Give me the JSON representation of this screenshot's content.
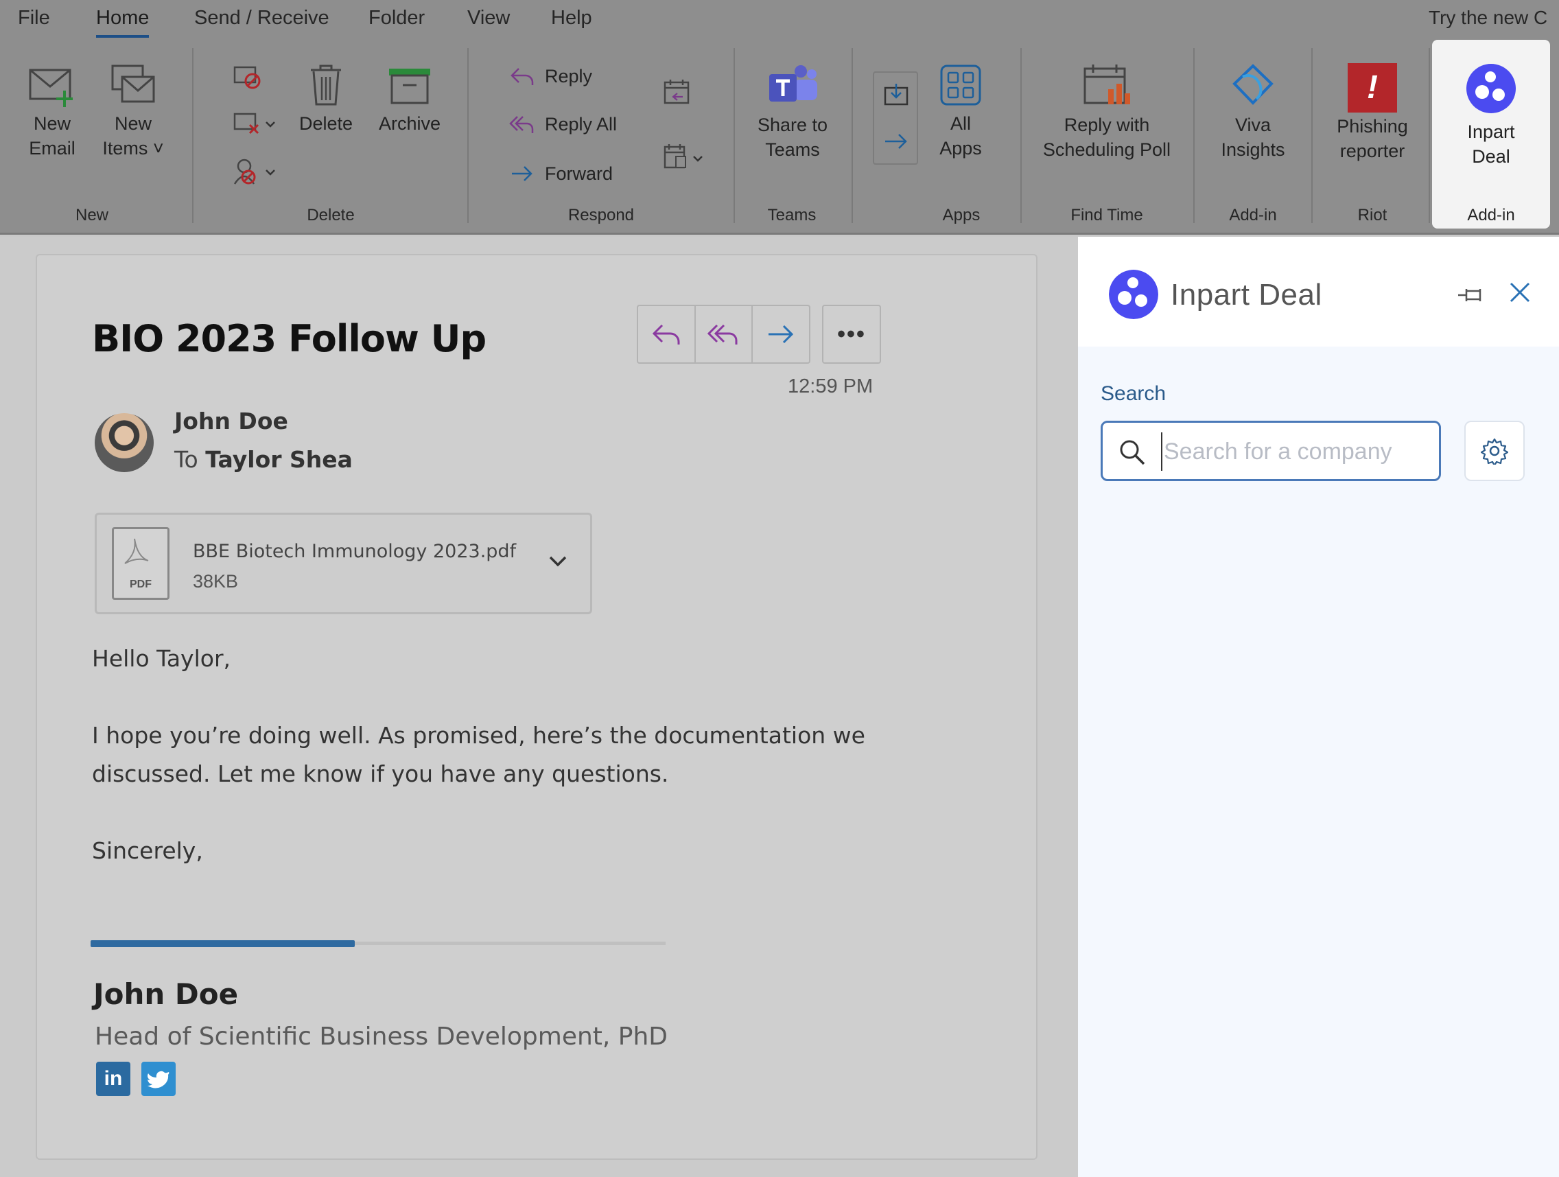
{
  "menu": {
    "tabs": [
      "File",
      "Home",
      "Send / Receive",
      "Folder",
      "View",
      "Help"
    ],
    "active_tab": "Home",
    "try_new": "Try the new C"
  },
  "ribbon": {
    "new_email": "New\nEmail",
    "new_items": "New\nItems ˅",
    "delete": "Delete",
    "archive": "Archive",
    "reply": "Reply",
    "reply_all": "Reply All",
    "forward": "Forward",
    "share_to_teams": "Share to\nTeams",
    "all_apps": "All\nApps",
    "reply_with_poll": "Reply with\nScheduling Poll",
    "viva_insights": "Viva\nInsights",
    "phishing_reporter": "Phishing\nreporter",
    "inpart_deal": "Inpart\nDeal",
    "groups": {
      "new": "New",
      "delete": "Delete",
      "respond": "Respond",
      "teams": "Teams",
      "apps": "Apps",
      "find_time": "Find Time",
      "addin1": "Add-in",
      "riot": "Riot",
      "addin2": "Add-in"
    }
  },
  "email": {
    "subject": "BIO 2023 Follow Up",
    "time": "12:59 PM",
    "sender": "John Doe",
    "to_prefix": "To",
    "recipient": "Taylor Shea",
    "attachment": {
      "name": "BBE Biotech Immunology 2023.pdf",
      "size": "38KB",
      "icon_text": "PDF"
    },
    "greeting": "Hello Taylor,",
    "body_line1": "I hope you’re doing well. As promised, here’s the documentation we",
    "body_line2": "discussed. Let me know if you have any questions.",
    "closing": "Sincerely,",
    "signature": {
      "name": "John Doe",
      "title": "Head of Scientific Business Development, PhD",
      "linkedin": "in"
    }
  },
  "addin": {
    "title": "Inpart Deal",
    "search_label": "Search",
    "search_placeholder": "Search for a company",
    "accent": "#4b4bf0"
  },
  "colors": {
    "ribbon_bg": "#8e8e8e",
    "email_bg": "#cbcbcb",
    "addin_bg": "#f4f8fe",
    "active_tab_underline": "#1d4f87",
    "signature_accent": "#2f6aa0",
    "phishing_red": "#b3262a"
  }
}
